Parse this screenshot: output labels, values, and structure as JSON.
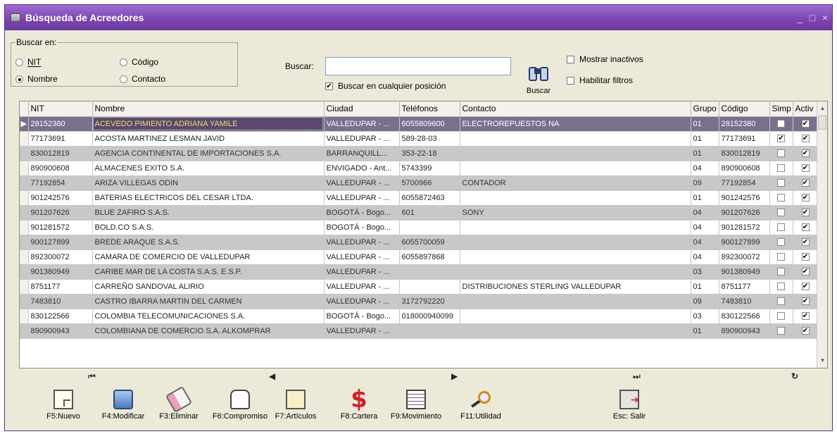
{
  "window": {
    "title": "Búsqueda de Acreedores"
  },
  "search": {
    "group_label": "Buscar en:",
    "options": [
      {
        "label": "NIT",
        "checked": false
      },
      {
        "label": "Código",
        "checked": false
      },
      {
        "label": "Nombre",
        "checked": true
      },
      {
        "label": "Contacto",
        "checked": false
      }
    ],
    "search_label": "Buscar:",
    "search_value": "",
    "any_position_label": "Buscar en cualquier posición",
    "any_position_checked": true,
    "search_button_label": "Buscar",
    "show_inactive_label": "Mostrar inactivos",
    "show_inactive_checked": false,
    "enable_filters_label": "Habilitar filtros",
    "enable_filters_checked": false
  },
  "grid": {
    "columns": [
      "NIT",
      "Nombre",
      "Ciudad",
      "Teléfonos",
      "Contacto",
      "Grupo",
      "Código",
      "Simp",
      "Activ"
    ],
    "rows": [
      {
        "nit": "28152380",
        "nombre": "ACEVEDO PIMIENTO ADRIANA YAMILE",
        "ciudad": "VALLEDUPAR - ...",
        "telefonos": "6055809600",
        "contacto": "ELECTROREPUESTOS NA",
        "grupo": "01",
        "codigo": "28152380",
        "simp": false,
        "activ": true
      },
      {
        "nit": "77173691",
        "nombre": "ACOSTA MARTINEZ LESMAN JAVID",
        "ciudad": "VALLEDUPAR - ...",
        "telefonos": "589-28-03",
        "contacto": "",
        "grupo": "01",
        "codigo": "77173691",
        "simp": true,
        "activ": true
      },
      {
        "nit": "830012819",
        "nombre": "AGENCIA CONTINENTAL DE IMPORTACIONES S.A.",
        "ciudad": "BARRANQUILL...",
        "telefonos": "353-22-18",
        "contacto": "",
        "grupo": "01",
        "codigo": "830012819",
        "simp": false,
        "activ": true
      },
      {
        "nit": "890900608",
        "nombre": "ALMACENES EXITO S.A.",
        "ciudad": "ENVIGADO - Ant...",
        "telefonos": "5743399",
        "contacto": "",
        "grupo": "04",
        "codigo": "890900608",
        "simp": false,
        "activ": true
      },
      {
        "nit": "77192854",
        "nombre": "ARIZA VILLEGAS ODIN",
        "ciudad": "VALLEDUPAR - ...",
        "telefonos": "5700966",
        "contacto": "CONTADOR",
        "grupo": "09",
        "codigo": "77192854",
        "simp": false,
        "activ": true
      },
      {
        "nit": "901242576",
        "nombre": "BATERIAS ELECTRICOS DEL CESAR LTDA.",
        "ciudad": "VALLEDUPAR - ...",
        "telefonos": "6055872463",
        "contacto": "",
        "grupo": "01",
        "codigo": "901242576",
        "simp": false,
        "activ": true
      },
      {
        "nit": "901207626",
        "nombre": "BLUE ZAFIRO S.A.S.",
        "ciudad": "BOGOTÁ - Bogo...",
        "telefonos": "601",
        "contacto": "SONY",
        "grupo": "04",
        "codigo": "901207626",
        "simp": false,
        "activ": true
      },
      {
        "nit": "901281572",
        "nombre": "BOLD.CO S.A.S.",
        "ciudad": "BOGOTÁ - Bogo...",
        "telefonos": "",
        "contacto": "",
        "grupo": "04",
        "codigo": "901281572",
        "simp": false,
        "activ": true
      },
      {
        "nit": "900127899",
        "nombre": "BREDE ARAQUE S.A.S.",
        "ciudad": "VALLEDUPAR - ...",
        "telefonos": "6055700059",
        "contacto": "",
        "grupo": "04",
        "codigo": "900127899",
        "simp": false,
        "activ": true
      },
      {
        "nit": "892300072",
        "nombre": "CAMARA DE COMERCIO DE VALLEDUPAR",
        "ciudad": "VALLEDUPAR - ...",
        "telefonos": "6055897868",
        "contacto": "",
        "grupo": "04",
        "codigo": "892300072",
        "simp": false,
        "activ": true
      },
      {
        "nit": "901380949",
        "nombre": "CARIBE MAR DE LA COSTA S.A.S. E.S.P.",
        "ciudad": "VALLEDUPAR - ...",
        "telefonos": "",
        "contacto": "",
        "grupo": "03",
        "codigo": "901380949",
        "simp": false,
        "activ": true
      },
      {
        "nit": "8751177",
        "nombre": "CARREÑO SANDOVAL ALIRIO",
        "ciudad": "VALLEDUPAR - ...",
        "telefonos": "",
        "contacto": "DISTRIBUCIONES STERLING VALLEDUPAR",
        "grupo": "01",
        "codigo": "8751177",
        "simp": false,
        "activ": true
      },
      {
        "nit": "7483810",
        "nombre": "CASTRO IBARRA MARTIN DEL CARMEN",
        "ciudad": "VALLEDUPAR - ...",
        "telefonos": "3172792220",
        "contacto": "",
        "grupo": "09",
        "codigo": "7483810",
        "simp": false,
        "activ": true
      },
      {
        "nit": "830122566",
        "nombre": "COLOMBIA TELECOMUNICACIONES S.A.",
        "ciudad": "BOGOTÁ - Bogo...",
        "telefonos": "018000940099",
        "contacto": "",
        "grupo": "03",
        "codigo": "830122566",
        "simp": false,
        "activ": true
      },
      {
        "nit": "890900943",
        "nombre": "COLOMBIANA DE COMERCIO S.A.   ALKOMPRAR",
        "ciudad": "VALLEDUPAR - ...",
        "telefonos": "",
        "contacto": "",
        "grupo": "01",
        "codigo": "890900943",
        "simp": false,
        "activ": true
      }
    ]
  },
  "toolbar": [
    {
      "label": "F5:Nuevo",
      "icon": "new-document-icon",
      "underline": "N"
    },
    {
      "label": "F4:Modificar",
      "icon": "edit-icon",
      "underline": "M"
    },
    {
      "label": "F3:Eliminar",
      "icon": "eraser-icon",
      "underline": "E"
    },
    {
      "label": "F6:Compromiso",
      "icon": "hand-icon",
      "underline": ""
    },
    {
      "label": "F7:Artículos",
      "icon": "list-icon",
      "underline": ""
    },
    {
      "label": "F8:Cartera",
      "icon": "dollar-icon",
      "underline": ""
    },
    {
      "label": "F9:Movimiento",
      "icon": "document-icon",
      "underline": ""
    },
    {
      "label": "F11:Utilidad",
      "icon": "magnifier-icon",
      "underline": ""
    },
    {
      "label": "Esc: Salir",
      "icon": "exit-door-icon",
      "underline": ""
    }
  ]
}
